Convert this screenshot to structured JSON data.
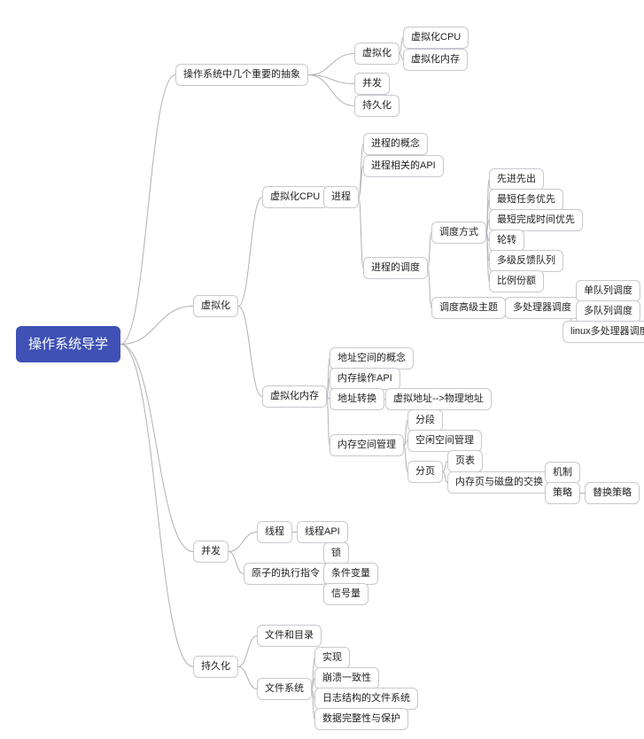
{
  "root": "操作系统导学",
  "branches": {
    "abstractions": {
      "label": "操作系统中几个重要的抽象",
      "children": {
        "virt": {
          "label": "虚拟化",
          "children": {
            "cpu": "虚拟化CPU",
            "mem": "虚拟化内存"
          }
        },
        "conc": "并发",
        "pers": "持久化"
      }
    },
    "virtualization": {
      "label": "虚拟化",
      "cpu": {
        "label": "虚拟化CPU",
        "process": {
          "label": "进程",
          "concept": "进程的概念",
          "api": "进程相关的API",
          "sched": {
            "label": "进程的调度",
            "mode": {
              "label": "调度方式",
              "items": [
                "先进先出",
                "最短任务优先",
                "最短完成时间优先",
                "轮转",
                "多级反馈队列",
                "比例份额"
              ]
            },
            "adv": {
              "label": "调度高级主题",
              "mp": {
                "label": "多处理器调度",
                "items": [
                  "单队列调度",
                  "多队列调度",
                  "linux多处理器调度"
                ]
              }
            }
          }
        }
      },
      "mem": {
        "label": "虚拟化内存",
        "concept": "地址空间的概念",
        "api": "内存操作API",
        "translate": {
          "label": "地址转换",
          "detail": "虚拟地址-->物理地址"
        },
        "space": {
          "label": "内存空间管理",
          "seg": "分段",
          "free": "空闲空间管理",
          "page": {
            "label": "分页",
            "table": "页表",
            "swap": {
              "label": "内存页与磁盘的交换",
              "mech": "机制",
              "policy": {
                "label": "策略",
                "detail": "替换策略"
              }
            }
          }
        }
      }
    },
    "concurrency": {
      "label": "并发",
      "thread": {
        "label": "线程",
        "api": "线程API"
      },
      "atomic": {
        "label": "原子的执行指令",
        "items": [
          "锁",
          "条件变量",
          "信号量"
        ]
      }
    },
    "persistence": {
      "label": "持久化",
      "fd": "文件和目录",
      "fs": {
        "label": "文件系统",
        "items": [
          "实现",
          "崩溃一致性",
          "日志结构的文件系统",
          "数据完整性与保护"
        ]
      }
    }
  }
}
